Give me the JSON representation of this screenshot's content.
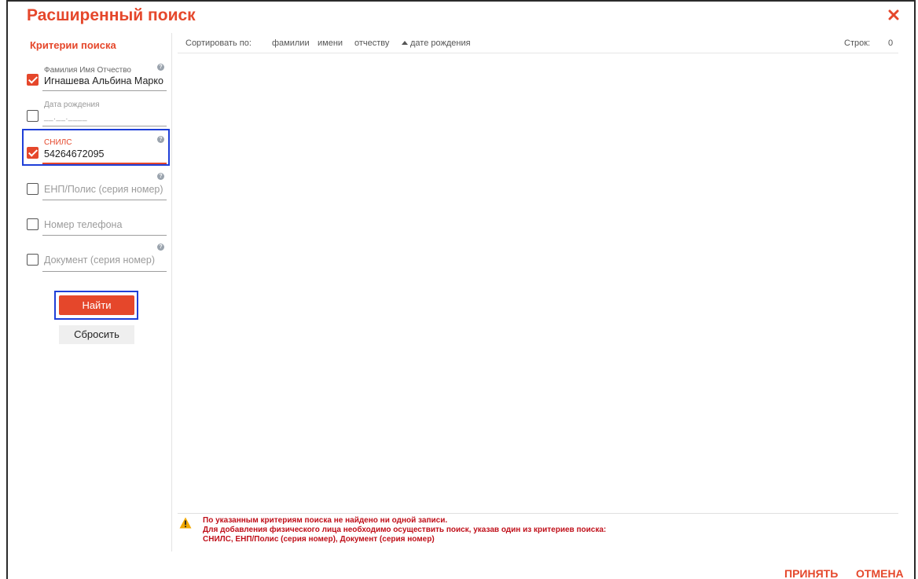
{
  "dialog": {
    "title": "Расширенный поиск",
    "close_icon": "close-x-icon",
    "accent_color": "#e5472b"
  },
  "sidebar": {
    "title": "Критерии поиска",
    "fields": [
      {
        "label": "Фамилия Имя Отчество",
        "value": "Игнашева Альбина Марко",
        "checked": true,
        "help": true
      },
      {
        "label": "Дата рождения",
        "value": "__.__.____",
        "checked": false,
        "help": false
      },
      {
        "label": "СНИЛС",
        "value": "54264672095",
        "checked": true,
        "help": true
      },
      {
        "placeholder": "ЕНП/Полис (серия номер)",
        "checked": false,
        "help": true
      },
      {
        "placeholder": "Номер телефона",
        "checked": false,
        "help": false
      },
      {
        "placeholder": "Документ (серия номер)",
        "checked": false,
        "help": true
      }
    ],
    "find_label": "Найти",
    "reset_label": "Сбросить"
  },
  "results": {
    "sort_label": "Сортировать по:",
    "sort_options": [
      "фамилии",
      "имени",
      "отчеству",
      "дате рождения"
    ],
    "rows_label": "Строк:",
    "rows_count": "0",
    "message": {
      "icon": "warning-icon",
      "lines": [
        "По указанным критериям поиска не найдено ни одной записи.",
        "Для добавления физического лица необходимо осуществить поиск, указав один из критериев поиска:",
        "СНИЛС, ЕНП/Полис (серия номер), Документ (серия номер)"
      ]
    }
  },
  "footer": {
    "accept_label": "ПРИНЯТЬ",
    "cancel_label": "ОТМЕНА"
  }
}
